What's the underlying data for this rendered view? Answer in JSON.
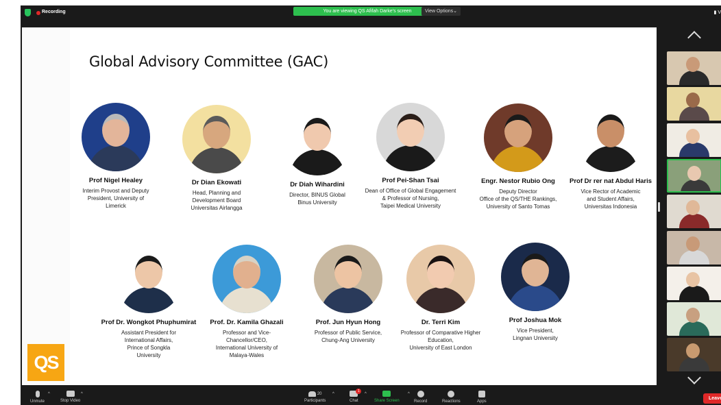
{
  "topbar": {
    "recording_label": "Recording",
    "viewing_banner": "You are viewing QS Afifah Darke's screen",
    "view_options": "View Options",
    "view_right": "V"
  },
  "slide": {
    "title": "Global Advisory Committee (GAC)",
    "logo_text": "QS",
    "members": [
      {
        "name": "Prof Nigel Healey",
        "role": "Interim Provost and Deputy\nPresident, University of\nLimerick",
        "skin": "#e3b59a",
        "hair": "#b9b9b9",
        "bg": "#1f3f8a",
        "clothes": "#2b3a5a"
      },
      {
        "name": "Dr Dian Ekowati",
        "role": "Head, Planning and\nDevelopment Board\nUniversitas Airlangga",
        "skin": "#d7a77e",
        "hair": "#5a5a5a",
        "bg": "#f3e0a0",
        "clothes": "#4a4a4a"
      },
      {
        "name": "Dr Diah Wihardini",
        "role": "Director, BINUS Global\nBinus University",
        "skin": "#f0c9ae",
        "hair": "#1a1a1a",
        "bg": "#ffffff",
        "clothes": "#1a1a1a"
      },
      {
        "name": "Prof Pei-Shan Tsai",
        "role": "Dean of Office of Global Engagement\n& Professor of Nursing,\nTaipei Medical University",
        "skin": "#f2cdb3",
        "hair": "#2a1e18",
        "bg": "#d8d8d8",
        "clothes": "#1a1a1a"
      },
      {
        "name": "Engr. Nestor Rubio Ong",
        "role": "Deputy Director\nOffice of the QS/THE Rankings,\nUniversity of Santo Tomas",
        "skin": "#d6a27c",
        "hair": "#1a1a1a",
        "bg": "#6f3a2a",
        "clothes": "#d39a1a"
      },
      {
        "name": "Prof Dr rer nat Abdul Haris",
        "role": "Vice Rector of Academic\nand Student Affairs,\nUniversitas Indonesia",
        "skin": "#c98f68",
        "hair": "#1a1a1a",
        "bg": "#ffffff",
        "clothes": "#1c1c1c"
      },
      {
        "name": "Prof Dr. Wongkot Phuphumirat",
        "role": "Assistant President for\nInternational Affairs,\nPrince of Songkla\nUniversity",
        "skin": "#edc7a8",
        "hair": "#1a1a1a",
        "bg": "#ffffff",
        "clothes": "#1e2f4a"
      },
      {
        "name": "Prof. Dr. Kamila Ghazali",
        "role": "Professor and Vice-\nChancellor/CEO,\nInternational University of\nMalaya-Wales",
        "skin": "#e1b08e",
        "hair": "#d7d2c5",
        "bg": "#3c9ad8",
        "clothes": "#e7e0d0"
      },
      {
        "name": "Prof. Jun Hyun Hong",
        "role": "Professor of Public Service,\nChung-Ang University",
        "skin": "#edc4a3",
        "hair": "#1a1a1a",
        "bg": "#c8b8a0",
        "clothes": "#2a3a5a"
      },
      {
        "name": "Dr. Terri Kim",
        "role": "Professor of Comparative Higher\nEducation,\nUniversity of East London",
        "skin": "#f2cbb0",
        "hair": "#1a1212",
        "bg": "#e8c9a8",
        "clothes": "#3a2a2a"
      },
      {
        "name": "Prof Joshua Mok",
        "role": "Vice President,\nLingnan University",
        "skin": "#e0b595",
        "hair": "#1a1a1a",
        "bg": "#1a2a4a",
        "clothes": "#2a4a8a"
      }
    ]
  },
  "gallery": {
    "tiles": [
      {
        "bg": "#d8c8b0",
        "skin": "#c99a78",
        "clothes": "#2a2a2a"
      },
      {
        "bg": "#e8d8a0",
        "skin": "#9a6a4a",
        "clothes": "#5a4a4a"
      },
      {
        "bg": "#f0ece4",
        "skin": "#e8c0a0",
        "clothes": "#2a3a6a"
      },
      {
        "bg": "#8aa07a",
        "skin": "#e8c8b0",
        "clothes": "#3a3a3a"
      },
      {
        "bg": "#e0dad0",
        "skin": "#e0b898",
        "clothes": "#8a2a2a"
      },
      {
        "bg": "#c8b8a8",
        "skin": "#c89a78",
        "clothes": "#d8d8d8"
      },
      {
        "bg": "#f4f0ea",
        "skin": "#e8c4a4",
        "clothes": "#1a1a1a"
      },
      {
        "bg": "#e0e8d8",
        "skin": "#c8a080",
        "clothes": "#2a6a5a"
      },
      {
        "bg": "#4a3a2a",
        "skin": "#c89a70",
        "clothes": "#3a3a3a"
      }
    ]
  },
  "toolbar": {
    "unmute": "Unmute",
    "stop_video": "Stop Video",
    "participants_count": "20",
    "participants": "Participants",
    "chat": "Chat",
    "chat_badge": "1",
    "share_screen": "Share Screen",
    "record": "Record",
    "reactions": "Reactions",
    "apps": "Apps",
    "leave": "Leave"
  }
}
